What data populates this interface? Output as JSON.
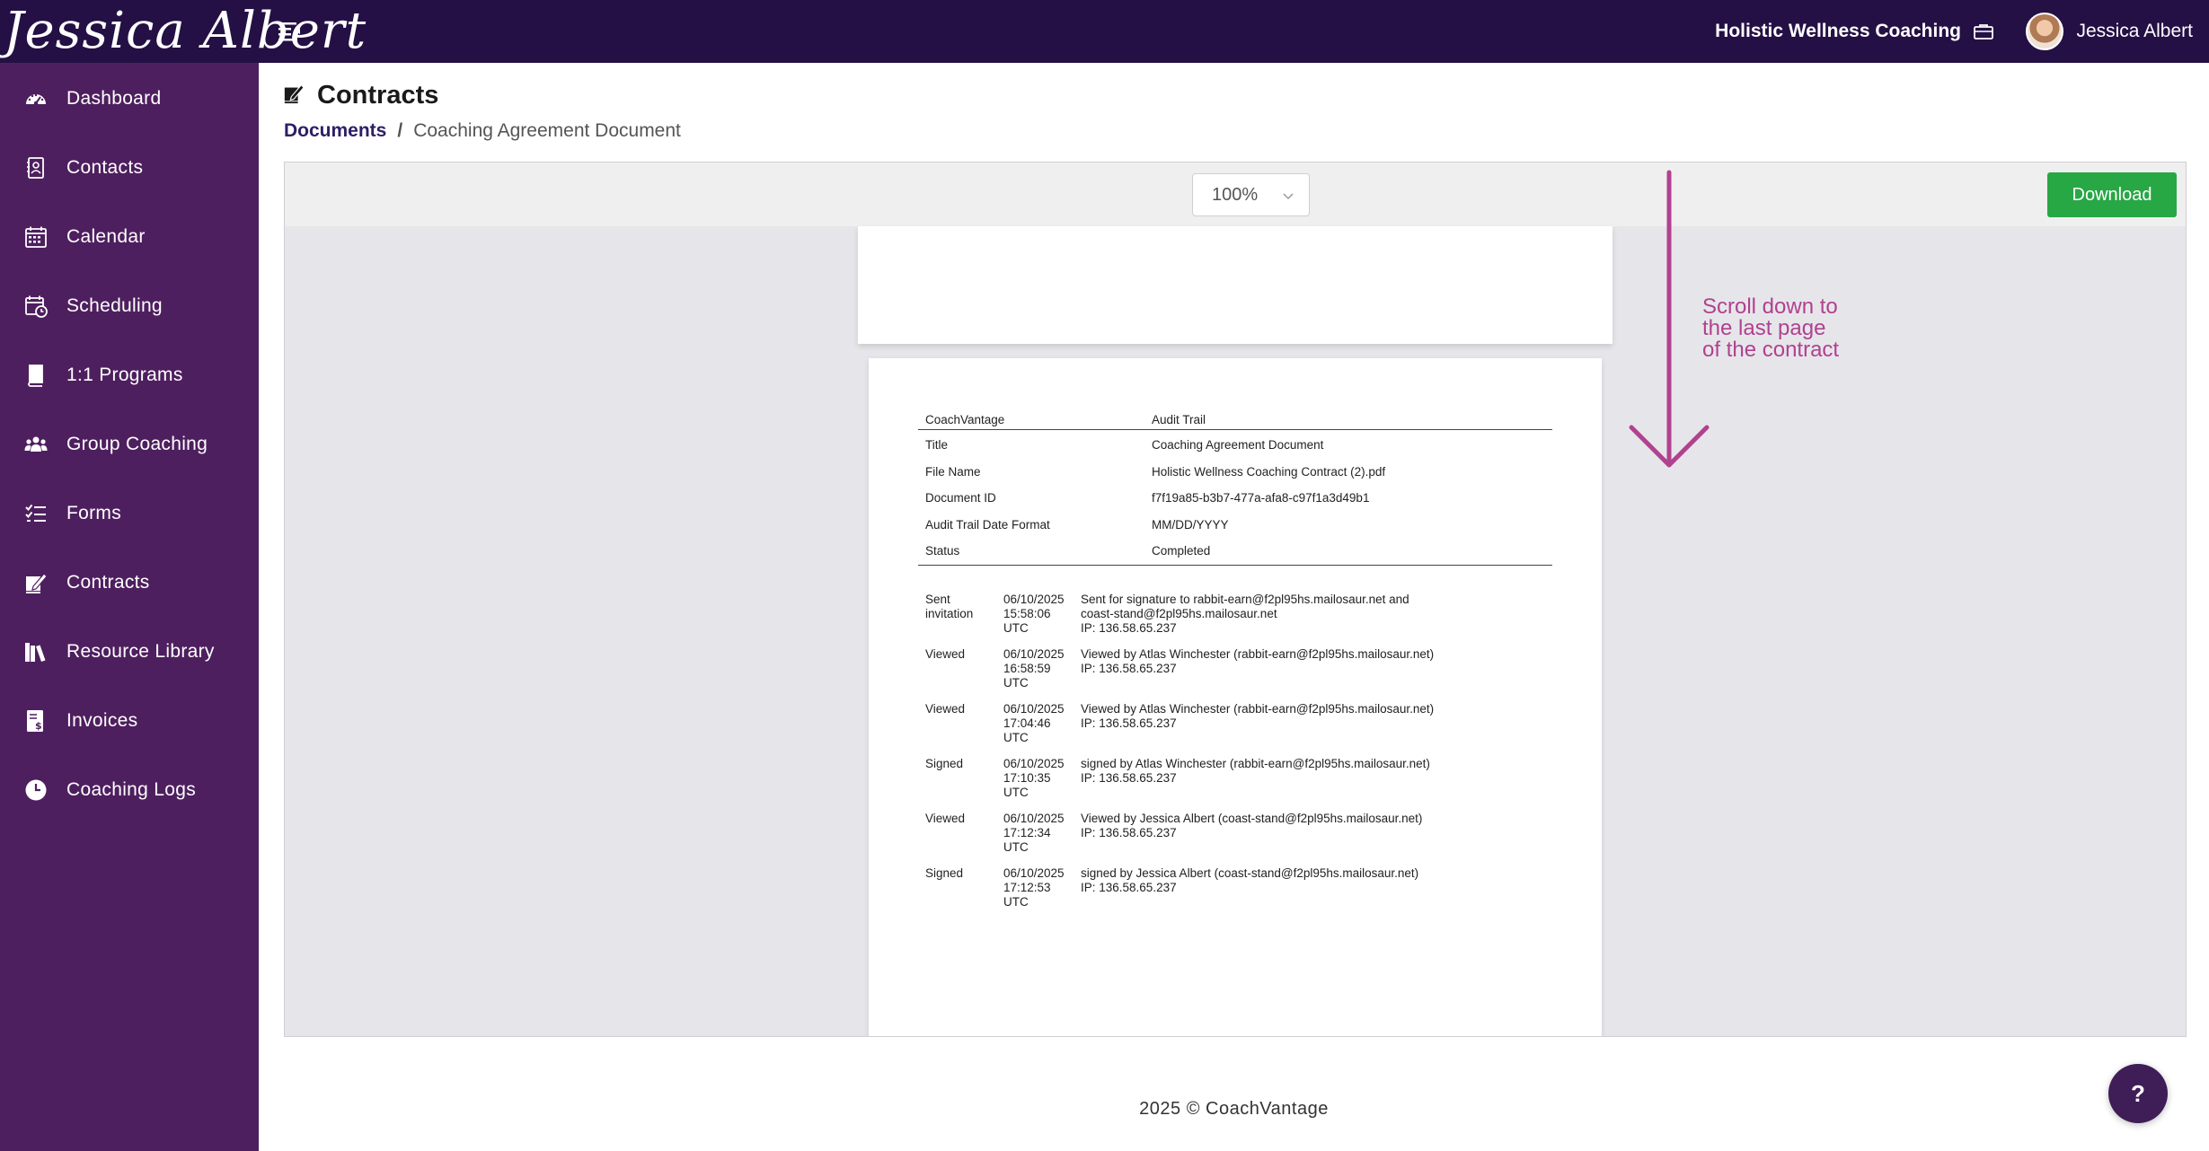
{
  "app": {
    "logo_text": "Jessica Albert",
    "business_name": "Holistic Wellness Coaching",
    "user_name": "Jessica Albert"
  },
  "sidebar": {
    "items": [
      {
        "label": "Dashboard",
        "icon": "dashboard-icon"
      },
      {
        "label": "Contacts",
        "icon": "contacts-icon"
      },
      {
        "label": "Calendar",
        "icon": "calendar-icon"
      },
      {
        "label": "Scheduling",
        "icon": "scheduling-icon"
      },
      {
        "label": "1:1 Programs",
        "icon": "book-icon"
      },
      {
        "label": "Group Coaching",
        "icon": "group-icon"
      },
      {
        "label": "Forms",
        "icon": "checklist-icon"
      },
      {
        "label": "Contracts",
        "icon": "signature-icon"
      },
      {
        "label": "Resource Library",
        "icon": "library-icon"
      },
      {
        "label": "Invoices",
        "icon": "invoice-icon"
      },
      {
        "label": "Coaching Logs",
        "icon": "clock-icon"
      }
    ]
  },
  "page": {
    "title": "Contracts",
    "breadcrumb_link": "Documents",
    "breadcrumb_sep": "/",
    "breadcrumb_current": "Coaching Agreement Document"
  },
  "viewer": {
    "zoom": "100%",
    "download_label": "Download"
  },
  "audit": {
    "header_left": "CoachVantage",
    "header_right": "Audit Trail",
    "info": [
      {
        "label": "Title",
        "value": "Coaching Agreement Document"
      },
      {
        "label": "File Name",
        "value": "Holistic Wellness Coaching Contract (2).pdf"
      },
      {
        "label": "Document ID",
        "value": "f7f19a85-b3b7-477a-afa8-c97f1a3d49b1"
      },
      {
        "label": "Audit Trail Date Format",
        "value": "MM/DD/YYYY"
      },
      {
        "label": "Status",
        "value": "Completed"
      }
    ],
    "events": [
      {
        "type": [
          "Sent",
          "invitation"
        ],
        "date": [
          "06/10/2025",
          "15:58:06",
          "UTC"
        ],
        "desc": [
          "Sent for signature to rabbit-earn@f2pl95hs.mailosaur.net and",
          "coast-stand@f2pl95hs.mailosaur.net",
          "IP: 136.58.65.237"
        ]
      },
      {
        "type": [
          "Viewed"
        ],
        "date": [
          "06/10/2025",
          "16:58:59",
          "UTC"
        ],
        "desc": [
          "Viewed by Atlas Winchester (rabbit-earn@f2pl95hs.mailosaur.net)",
          "IP: 136.58.65.237"
        ]
      },
      {
        "type": [
          "Viewed"
        ],
        "date": [
          "06/10/2025",
          "17:04:46",
          "UTC"
        ],
        "desc": [
          "Viewed by Atlas Winchester (rabbit-earn@f2pl95hs.mailosaur.net)",
          "IP: 136.58.65.237"
        ]
      },
      {
        "type": [
          "Signed"
        ],
        "date": [
          "06/10/2025",
          "17:10:35",
          "UTC"
        ],
        "desc": [
          "signed by Atlas Winchester (rabbit-earn@f2pl95hs.mailosaur.net)",
          "IP: 136.58.65.237"
        ]
      },
      {
        "type": [
          "Viewed"
        ],
        "date": [
          "06/10/2025",
          "17:12:34",
          "UTC"
        ],
        "desc": [
          "Viewed by Jessica Albert (coast-stand@f2pl95hs.mailosaur.net)",
          "IP: 136.58.65.237"
        ]
      },
      {
        "type": [
          "Signed"
        ],
        "date": [
          "06/10/2025",
          "17:12:53",
          "UTC"
        ],
        "desc": [
          "signed by Jessica Albert (coast-stand@f2pl95hs.mailosaur.net)",
          "IP: 136.58.65.237"
        ]
      }
    ]
  },
  "annotation": {
    "lines": [
      "Scroll down to",
      "the last page",
      "of the contract"
    ],
    "color": "#b1418f"
  },
  "footer": {
    "text": "2025 © CoachVantage"
  },
  "help": {
    "label": "?"
  },
  "colors": {
    "topbar": "#241045",
    "sidebar": "#4e1f5f",
    "download": "#28a745",
    "help": "#3f1d57"
  }
}
